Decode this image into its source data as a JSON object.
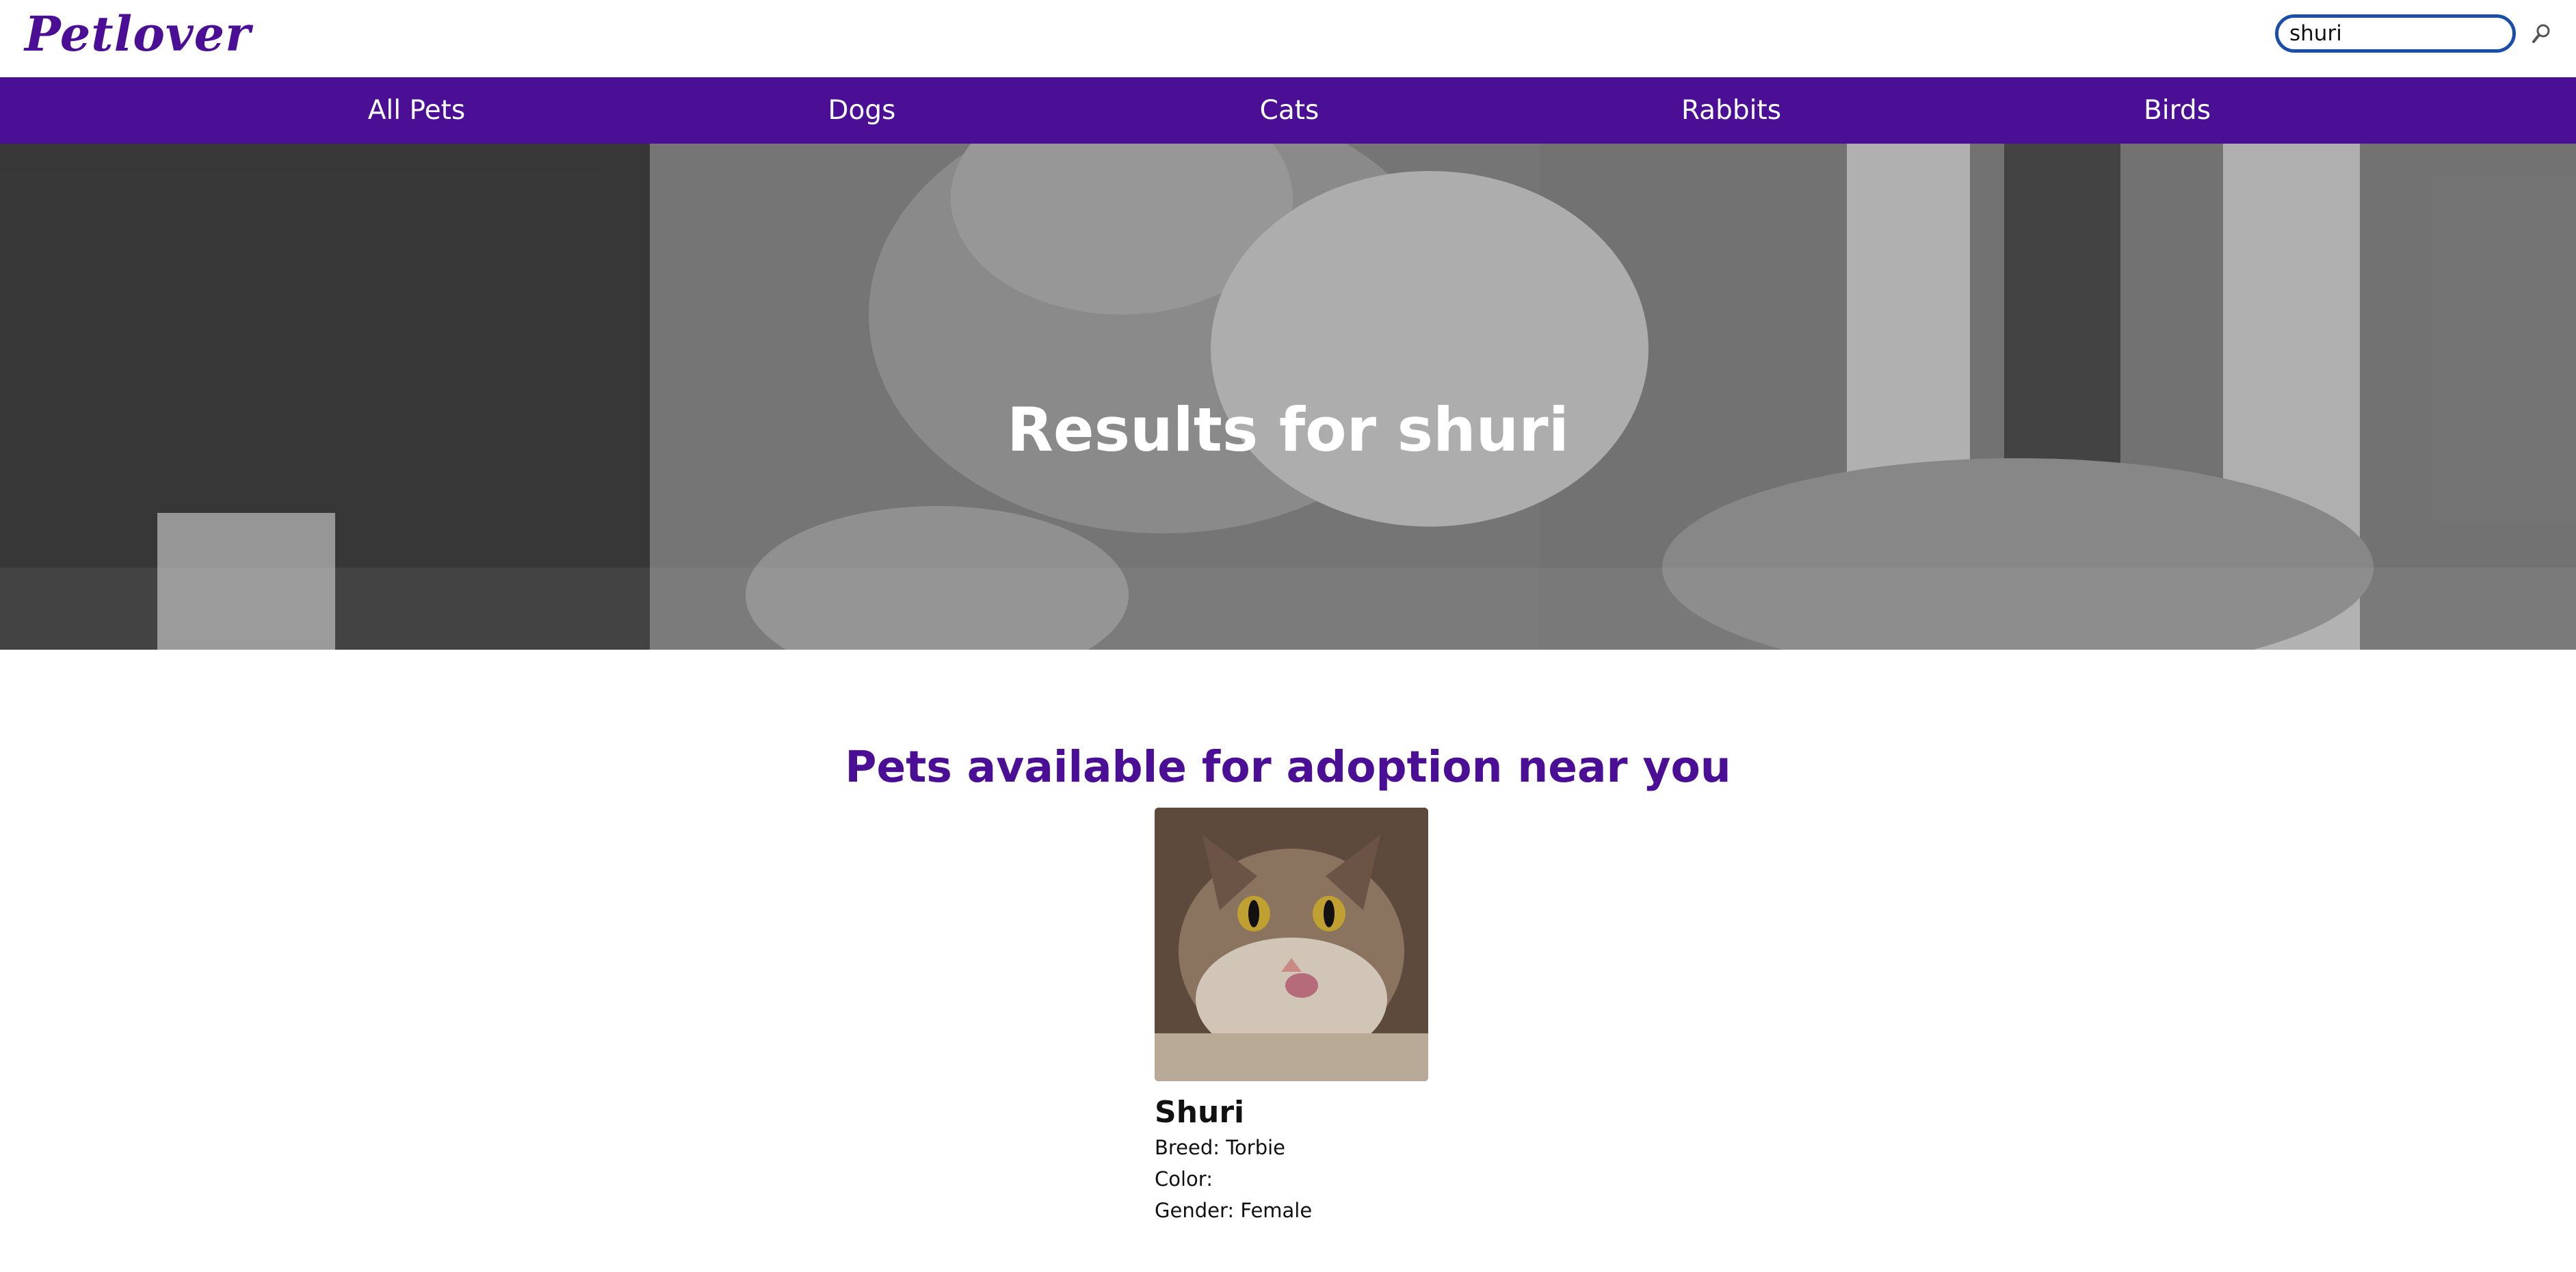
{
  "brand": {
    "name": "Petlover",
    "accent": "#4b0f96"
  },
  "search": {
    "value": "shuri",
    "icon": "search-icon"
  },
  "nav": {
    "items": [
      {
        "label": "All Pets"
      },
      {
        "label": "Dogs"
      },
      {
        "label": "Cats"
      },
      {
        "label": "Rabbits"
      },
      {
        "label": "Birds"
      }
    ]
  },
  "hero": {
    "title": "Results for shuri"
  },
  "section": {
    "title": "Pets available for adoption near you"
  },
  "pets": [
    {
      "name": "Shuri",
      "breed_label": "Breed: Torbie",
      "color_label": "Color:",
      "gender_label": "Gender: Female"
    }
  ]
}
